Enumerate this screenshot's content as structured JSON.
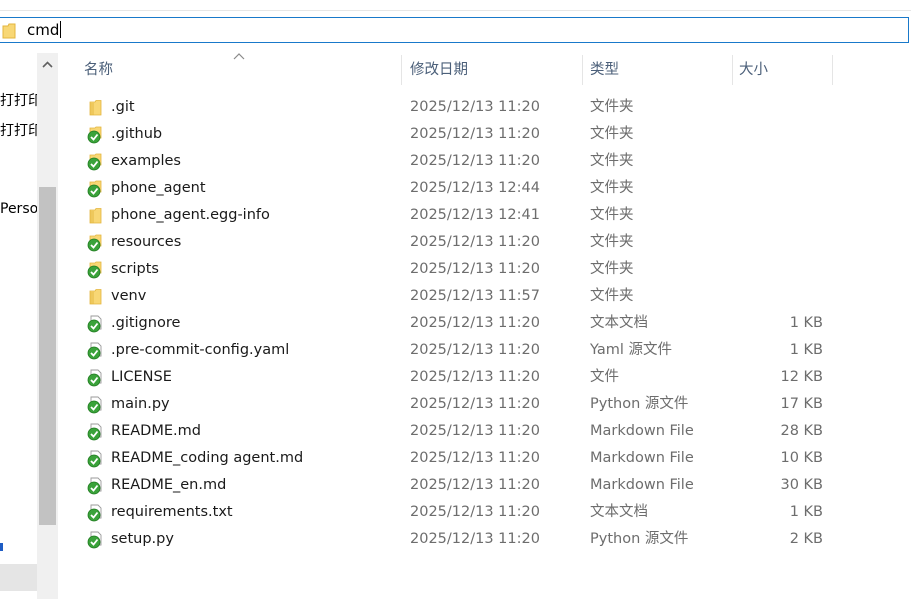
{
  "address": {
    "folder_icon": "folder-icon",
    "text": "cmd"
  },
  "left_pane": {
    "line1": "打打印能",
    "line2": "打打印能",
    "line3": "Perso"
  },
  "columns": {
    "name": "名称",
    "date": "修改日期",
    "type": "类型",
    "size": "大小"
  },
  "files": [
    {
      "name": ".git",
      "date": "2025/12/13 11:20",
      "type": "文件夹",
      "size": "",
      "icon": "folder-icon"
    },
    {
      "name": ".github",
      "date": "2025/12/13 11:20",
      "type": "文件夹",
      "size": "",
      "icon": "git-synced-folder-icon"
    },
    {
      "name": "examples",
      "date": "2025/12/13 11:20",
      "type": "文件夹",
      "size": "",
      "icon": "git-synced-folder-icon"
    },
    {
      "name": "phone_agent",
      "date": "2025/12/13 12:44",
      "type": "文件夹",
      "size": "",
      "icon": "git-synced-folder-icon"
    },
    {
      "name": "phone_agent.egg-info",
      "date": "2025/12/13 12:41",
      "type": "文件夹",
      "size": "",
      "icon": "folder-icon"
    },
    {
      "name": "resources",
      "date": "2025/12/13 11:20",
      "type": "文件夹",
      "size": "",
      "icon": "git-synced-folder-icon"
    },
    {
      "name": "scripts",
      "date": "2025/12/13 11:20",
      "type": "文件夹",
      "size": "",
      "icon": "git-synced-folder-icon"
    },
    {
      "name": "venv",
      "date": "2025/12/13 11:57",
      "type": "文件夹",
      "size": "",
      "icon": "folder-icon"
    },
    {
      "name": ".gitignore",
      "date": "2025/12/13 11:20",
      "type": "文本文档",
      "size": "1 KB",
      "icon": "git-synced-file-icon"
    },
    {
      "name": ".pre-commit-config.yaml",
      "date": "2025/12/13 11:20",
      "type": "Yaml 源文件",
      "size": "1 KB",
      "icon": "git-synced-file-icon"
    },
    {
      "name": "LICENSE",
      "date": "2025/12/13 11:20",
      "type": "文件",
      "size": "12 KB",
      "icon": "git-synced-file-icon"
    },
    {
      "name": "main.py",
      "date": "2025/12/13 11:20",
      "type": "Python 源文件",
      "size": "17 KB",
      "icon": "git-synced-file-icon"
    },
    {
      "name": "README.md",
      "date": "2025/12/13 11:20",
      "type": "Markdown File",
      "size": "28 KB",
      "icon": "git-synced-file-icon"
    },
    {
      "name": "README_coding agent.md",
      "date": "2025/12/13 11:20",
      "type": "Markdown File",
      "size": "10 KB",
      "icon": "git-synced-file-icon"
    },
    {
      "name": "README_en.md",
      "date": "2025/12/13 11:20",
      "type": "Markdown File",
      "size": "30 KB",
      "icon": "git-synced-file-icon"
    },
    {
      "name": "requirements.txt",
      "date": "2025/12/13 11:20",
      "type": "文本文档",
      "size": "1 KB",
      "icon": "git-synced-file-icon"
    },
    {
      "name": "setup.py",
      "date": "2025/12/13 11:20",
      "type": "Python 源文件",
      "size": "2 KB",
      "icon": "git-synced-file-icon"
    }
  ],
  "colors": {
    "folder": "#f8d775",
    "folder_dark": "#e3b53d",
    "git_green": "#3aa23a",
    "header_text": "#4c607a",
    "address_border": "#1979ca"
  }
}
